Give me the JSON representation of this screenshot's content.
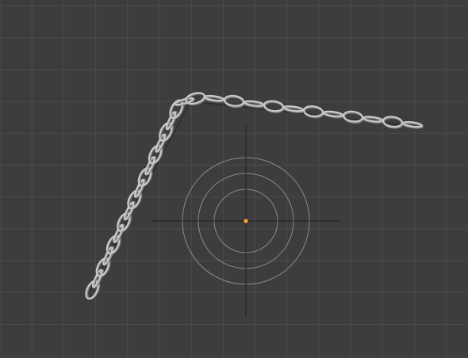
{
  "viewport": {
    "background_color": "#3d3d3d",
    "grid_color": "#4b4b4b",
    "guide_line_color": "#262626",
    "chain_color": "#c9c9c9",
    "chain_shadow_color": "#7e7e7e",
    "cursor_ring_color": "#8b8b8b",
    "cursor_cross_color": "#202020",
    "origin_color": "#ffa033"
  },
  "scene": {
    "objects": [
      {
        "name": "chain",
        "type": "array-curve-object"
      },
      {
        "name": "curve-guide",
        "type": "bezier-path"
      }
    ],
    "icons": [
      "3d-cursor-icon",
      "origin-dot-icon"
    ]
  }
}
